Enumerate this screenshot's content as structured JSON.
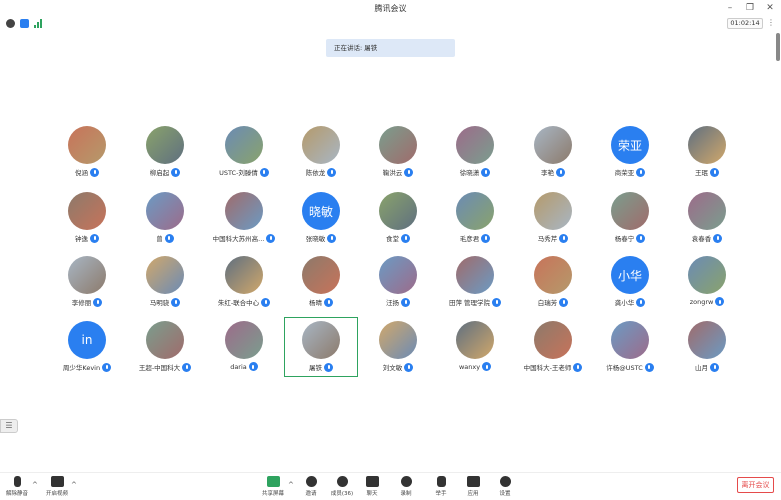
{
  "window": {
    "title": "腾讯会议"
  },
  "header": {
    "timer": "01:02:14"
  },
  "speaking": {
    "label": "正在讲话:",
    "name": "屠铁"
  },
  "colors": {
    "accent": "#2a7ff0",
    "active_border": "#2ea35f",
    "leave": "#e54b4b"
  },
  "participants": [
    {
      "name": "倪涵",
      "avatar": "photo"
    },
    {
      "name": "柳启起",
      "avatar": "photo"
    },
    {
      "name": "USTC-刘滕倩",
      "avatar": "photo"
    },
    {
      "name": "陈依龙",
      "avatar": "photo"
    },
    {
      "name": "鞠洪云",
      "avatar": "photo"
    },
    {
      "name": "徐晓潇",
      "avatar": "photo"
    },
    {
      "name": "李艳",
      "avatar": "photo"
    },
    {
      "name": "商荣亚",
      "avatar": "text",
      "avatar_text": "荣亚"
    },
    {
      "name": "王珉",
      "avatar": "photo"
    },
    {
      "name": "钟逸",
      "avatar": "photo"
    },
    {
      "name": "曾",
      "avatar": "photo"
    },
    {
      "name": "中国科大苏州高...",
      "avatar": "photo"
    },
    {
      "name": "张晓敏",
      "avatar": "text",
      "avatar_text": "晓敏"
    },
    {
      "name": "食堂",
      "avatar": "photo"
    },
    {
      "name": "毛彦君",
      "avatar": "photo"
    },
    {
      "name": "马秀芹",
      "avatar": "photo"
    },
    {
      "name": "杨春宁",
      "avatar": "photo"
    },
    {
      "name": "袁春香",
      "avatar": "photo"
    },
    {
      "name": "李修丽",
      "avatar": "photo"
    },
    {
      "name": "马明骁",
      "avatar": "photo"
    },
    {
      "name": "朱红-联合中心",
      "avatar": "photo"
    },
    {
      "name": "杨晴",
      "avatar": "photo"
    },
    {
      "name": "汪扬",
      "avatar": "photo"
    },
    {
      "name": "田萍 管理学院",
      "avatar": "photo"
    },
    {
      "name": "白瑞芳",
      "avatar": "photo"
    },
    {
      "name": "龚小华",
      "avatar": "text",
      "avatar_text": "小华"
    },
    {
      "name": "zongrw",
      "avatar": "photo"
    },
    {
      "name": "周少华Kevin",
      "avatar": "text",
      "avatar_text": "in"
    },
    {
      "name": "王超-中国科大",
      "avatar": "photo"
    },
    {
      "name": "daria",
      "avatar": "photo"
    },
    {
      "name": "屠铁",
      "avatar": "photo",
      "active": true
    },
    {
      "name": "刘文敏",
      "avatar": "photo"
    },
    {
      "name": "wanxy",
      "avatar": "photo"
    },
    {
      "name": "中国科大-王老师",
      "avatar": "photo"
    },
    {
      "name": "许杨@USTC",
      "avatar": "photo"
    },
    {
      "name": "山月",
      "avatar": "photo"
    }
  ],
  "toolbar": {
    "mute": "解除静音",
    "video": "开启视频",
    "share": "共享屏幕",
    "invite": "邀请",
    "members": "成员(36)",
    "chat": "聊天",
    "record": "录制",
    "raise_hand": "举手",
    "apps": "应用",
    "settings": "设置",
    "leave": "离开会议"
  }
}
